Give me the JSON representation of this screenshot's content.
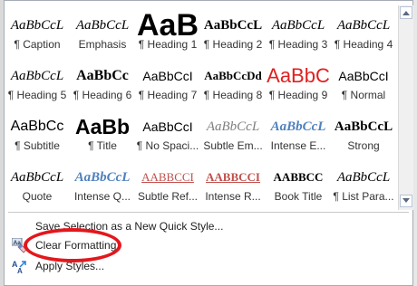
{
  "styles": [
    {
      "sample": "AaBbCcL",
      "label": "¶ Caption",
      "sample_style": "font-family:'Liberation Serif',serif;font-style:italic;font-size:15px;"
    },
    {
      "sample": "AaBbCcL",
      "label": "Emphasis",
      "sample_style": "font-family:'Liberation Serif',serif;font-style:italic;font-size:15px;"
    },
    {
      "sample": "AaB",
      "label": "¶ Heading 1",
      "sample_style": "font-family:'Liberation Sans',sans-serif;font-weight:bold;font-size:34px;"
    },
    {
      "sample": "AaBbCcL",
      "label": "¶ Heading 2",
      "sample_style": "font-family:'Liberation Serif',serif;font-weight:bold;font-size:15px;"
    },
    {
      "sample": "AaBbCcL",
      "label": "¶ Heading 3",
      "sample_style": "font-family:'Liberation Serif',serif;font-style:italic;font-size:15px;"
    },
    {
      "sample": "AaBbCcL",
      "label": "¶ Heading 4",
      "sample_style": "font-family:'Liberation Serif',serif;font-style:italic;font-size:15px;"
    },
    {
      "sample": "AaBbCcL",
      "label": "¶ Heading 5",
      "sample_style": "font-family:'Liberation Serif',serif;font-style:italic;font-size:15px;"
    },
    {
      "sample": "AaBbCc",
      "label": "¶ Heading 6",
      "sample_style": "font-family:'Liberation Serif',serif;font-weight:bold;font-size:16px;"
    },
    {
      "sample": "AaBbCcI",
      "label": "¶ Heading 7",
      "sample_style": "font-family:'Liberation Sans',sans-serif;font-size:14px;"
    },
    {
      "sample": "AaBbCcDd",
      "label": "¶ Heading 8",
      "sample_style": "font-family:'Liberation Serif',serif;font-weight:bold;font-size:13px;"
    },
    {
      "sample": "AaBbC",
      "label": "¶ Heading 9",
      "sample_style": "font-family:'Liberation Sans',sans-serif;font-size:22px;color:#e02020;"
    },
    {
      "sample": "AaBbCcI",
      "label": "¶ Normal",
      "sample_style": "font-family:'Liberation Sans',sans-serif;font-size:14px;"
    },
    {
      "sample": "AaBbCc",
      "label": "¶ Subtitle",
      "sample_style": "font-family:'Liberation Sans',sans-serif;font-size:16px;"
    },
    {
      "sample": "AaBb",
      "label": "¶ Title",
      "sample_style": "font-family:'Liberation Sans',sans-serif;font-weight:bold;font-size:23px;"
    },
    {
      "sample": "AaBbCcI",
      "label": "¶ No Spaci...",
      "sample_style": "font-family:'Liberation Sans',sans-serif;font-size:14px;"
    },
    {
      "sample": "AaBbCcL",
      "label": "Subtle Em...",
      "sample_style": "font-family:'Liberation Serif',serif;font-style:italic;font-size:15px;color:#7f7f7f;"
    },
    {
      "sample": "AaBbCcL",
      "label": "Intense E...",
      "sample_style": "font-family:'Liberation Serif',serif;font-style:italic;font-weight:bold;font-size:15px;color:#4f81bd;"
    },
    {
      "sample": "AaBbCcL",
      "label": "Strong",
      "sample_style": "font-family:'Liberation Serif',serif;font-weight:bold;font-size:15px;"
    },
    {
      "sample": "AaBbCcL",
      "label": "Quote",
      "sample_style": "font-family:'Liberation Serif',serif;font-style:italic;font-size:15px;"
    },
    {
      "sample": "AaBbCcL",
      "label": "Intense Q...",
      "sample_style": "font-family:'Liberation Serif',serif;font-style:italic;font-weight:bold;font-size:15px;color:#4f81bd;"
    },
    {
      "sample": "AABBCCI",
      "label": "Subtle Ref...",
      "sample_style": "font-family:'Liberation Serif',serif;font-size:13px;color:#c0504d;text-decoration:underline;"
    },
    {
      "sample": "AABBCCI",
      "label": "Intense R...",
      "sample_style": "font-family:'Liberation Serif',serif;font-weight:bold;font-size:13px;color:#c0504d;text-decoration:underline;"
    },
    {
      "sample": "AABBCC",
      "label": "Book Title",
      "sample_style": "font-family:'Liberation Serif',serif;font-weight:bold;font-size:13px;"
    },
    {
      "sample": "AaBbCcL",
      "label": "¶ List Para...",
      "sample_style": "font-family:'Liberation Serif',serif;font-style:italic;font-size:15px;"
    }
  ],
  "menu": {
    "save_selection": "Save Selection as a New Quick Style...",
    "clear_formatting": "Clear Formatting",
    "apply_styles": "Apply Styles..."
  },
  "colors": {
    "highlight_ellipse": "#e3171c",
    "accent_blue": "#4f81bd",
    "accent_red": "#c0504d"
  },
  "icons": {
    "scroll_up": "chevron-up-icon",
    "scroll_down": "chevron-down-icon",
    "clear_formatting": "clear-formatting-icon",
    "apply_styles": "apply-styles-icon"
  }
}
